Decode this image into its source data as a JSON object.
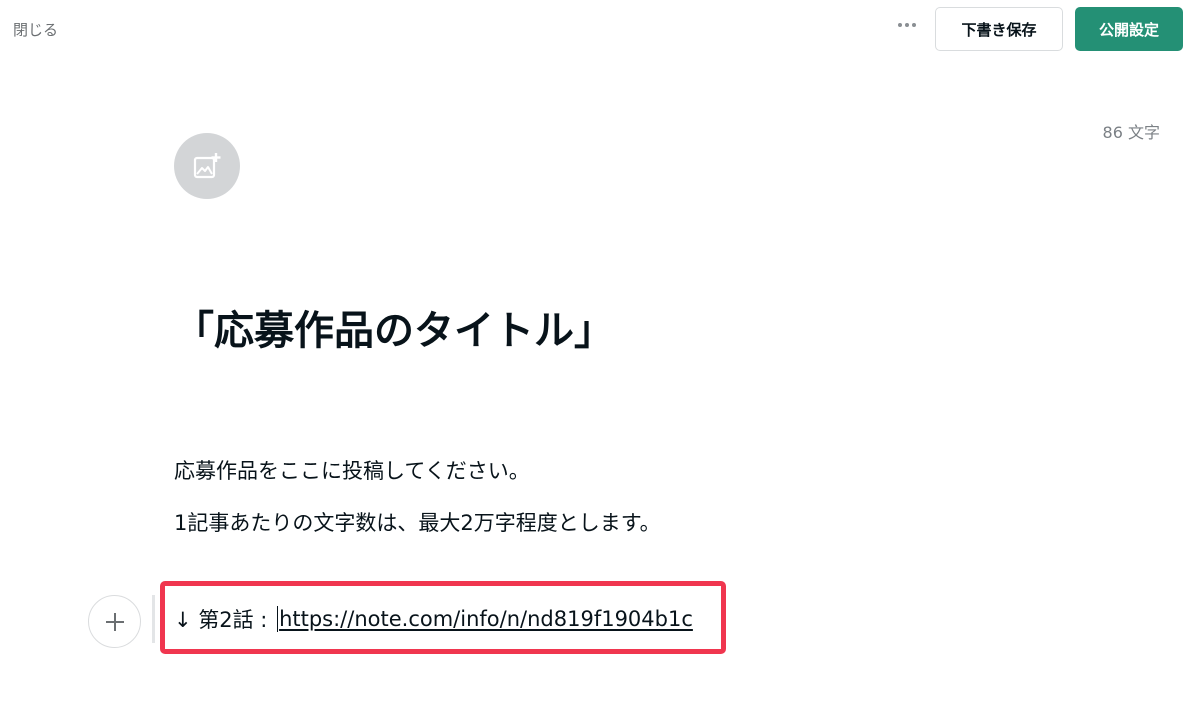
{
  "header": {
    "close_label": "閉じる",
    "more_icon": "more-horizontal-icon",
    "draft_save_label": "下書き保存",
    "publish_label": "公開設定"
  },
  "colors": {
    "accent_green": "#249075",
    "highlight_red": "#f0364f",
    "text_primary": "#08131a",
    "text_muted": "#7b8085"
  },
  "editor": {
    "char_count": "86 文字",
    "image_add_icon": "image-add-icon",
    "title": "「応募作品のタイトル」",
    "paragraphs": [
      "応募作品をここに投稿してください。",
      "1記事あたりの文字数は、最大2万字程度とします。"
    ],
    "link_line": {
      "prefix": "↓ 第2話 : ",
      "url": "https://note.com/info/n/nd819f1904b1c"
    },
    "block_add_icon": "plus-icon"
  }
}
